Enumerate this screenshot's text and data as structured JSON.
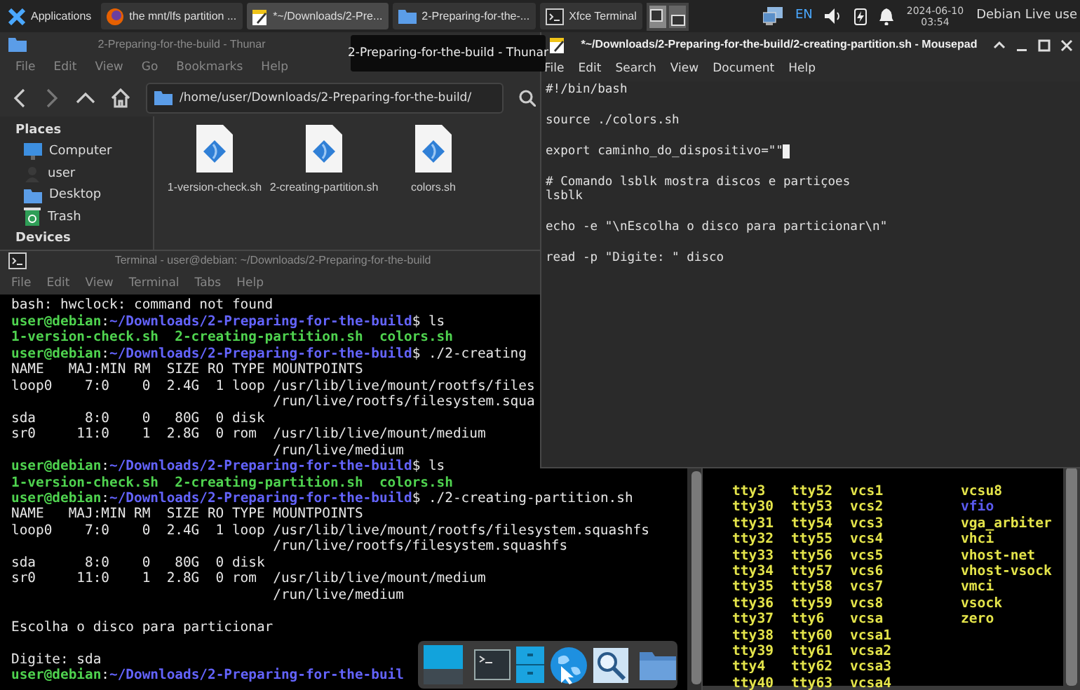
{
  "panel": {
    "menu_button": "Applications",
    "tasks": [
      {
        "label": "the mnt/lfs partition ...",
        "selected": false
      },
      {
        "label": "*~/Downloads/2-Pre...",
        "selected": true
      },
      {
        "label": "2-Preparing-for-the-...",
        "selected": false
      },
      {
        "label": "Xfce Terminal",
        "selected": false
      }
    ],
    "language": "EN",
    "date": "2024-06-10",
    "time": "03:54",
    "user": "Debian Live use"
  },
  "thunar": {
    "title": "2-Preparing-for-the-build - Thunar",
    "active": false,
    "menu": [
      "File",
      "Edit",
      "View",
      "Go",
      "Bookmarks",
      "Help"
    ],
    "path": "/home/user/Downloads/2-Preparing-for-the-build/",
    "sidebar": [
      {
        "kind": "heading",
        "label": "Places"
      },
      {
        "kind": "item",
        "label": "Computer"
      },
      {
        "kind": "item",
        "label": "user"
      },
      {
        "kind": "item",
        "label": "Desktop"
      },
      {
        "kind": "item",
        "label": "Trash"
      },
      {
        "kind": "heading",
        "label": "Devices"
      }
    ],
    "files": [
      {
        "name": "1-version-check.sh"
      },
      {
        "name": "2-creating-partition.sh"
      },
      {
        "name": "colors.sh"
      }
    ]
  },
  "tooltip": "2-Preparing-for-the-build - Thunar",
  "terminal": {
    "title": "Terminal - user@debian: ~/Downloads/2-Preparing-for-the-build",
    "active": false,
    "menu": [
      "File",
      "Edit",
      "View",
      "Terminal",
      "Tabs",
      "Help"
    ],
    "lines": [
      {
        "kind": "output",
        "blank_before": false,
        "text": "bash: hwclock: command not found"
      },
      {
        "kind": "prompt",
        "blank_before": false,
        "user": "user@debian",
        "separator": ":",
        "path": "~/Downloads/2-Preparing-for-the-build",
        "command": "$ ls"
      },
      {
        "kind": "file_list",
        "blank_before": false,
        "text": "1-version-check.sh  2-creating-partition.sh  colors.sh"
      },
      {
        "kind": "prompt",
        "blank_before": false,
        "user": "user@debian",
        "separator": ":",
        "path": "~/Downloads/2-Preparing-for-the-build",
        "command": "$ ./2-creating"
      },
      {
        "kind": "output",
        "blank_before": false,
        "text": "NAME   MAJ:MIN RM  SIZE RO TYPE MOUNTPOINTS"
      },
      {
        "kind": "output",
        "blank_before": false,
        "text": "loop0    7:0    0  2.4G  1 loop /usr/lib/live/mount/rootfs/files"
      },
      {
        "kind": "output",
        "blank_before": false,
        "text": "                                /run/live/rootfs/filesystem.squa"
      },
      {
        "kind": "output",
        "blank_before": false,
        "text": "sda      8:0    0   80G  0 disk"
      },
      {
        "kind": "output",
        "blank_before": false,
        "text": "sr0     11:0    1  2.8G  0 rom  /usr/lib/live/mount/medium"
      },
      {
        "kind": "output",
        "blank_before": false,
        "text": "                                /run/live/medium"
      },
      {
        "kind": "prompt",
        "blank_before": false,
        "user": "user@debian",
        "separator": ":",
        "path": "~/Downloads/2-Preparing-for-the-build",
        "command": "$ ls"
      },
      {
        "kind": "file_list",
        "blank_before": false,
        "text": "1-version-check.sh  2-creating-partition.sh  colors.sh"
      },
      {
        "kind": "prompt",
        "blank_before": false,
        "user": "user@debian",
        "separator": ":",
        "path": "~/Downloads/2-Preparing-for-the-build",
        "command": "$ ./2-creating-partition.sh"
      },
      {
        "kind": "output",
        "blank_before": false,
        "text": "NAME   MAJ:MIN RM  SIZE RO TYPE MOUNTPOINTS"
      },
      {
        "kind": "output",
        "blank_before": false,
        "text": "loop0    7:0    0  2.4G  1 loop /usr/lib/live/mount/rootfs/filesystem.squashfs"
      },
      {
        "kind": "output",
        "blank_before": false,
        "text": "                                /run/live/rootfs/filesystem.squashfs"
      },
      {
        "kind": "output",
        "blank_before": false,
        "text": "sda      8:0    0   80G  0 disk"
      },
      {
        "kind": "output",
        "blank_before": false,
        "text": "sr0     11:0    1  2.8G  0 rom  /usr/lib/live/mount/medium"
      },
      {
        "kind": "output",
        "blank_before": false,
        "text": "                                /run/live/medium"
      },
      {
        "kind": "output",
        "blank_before": true,
        "text": "Escolha o disco para particionar"
      },
      {
        "kind": "output",
        "blank_before": true,
        "text": "Digite: sda"
      },
      {
        "kind": "prompt",
        "blank_before": false,
        "user": "user@debian",
        "separator": ":",
        "path": "~/Downloads/2-Preparing-for-the-buil"
      }
    ]
  },
  "mousepad": {
    "title": "*~/Downloads/2-Preparing-for-the-build/2-creating-partition.sh - Mousepad",
    "active": true,
    "menu": [
      "File",
      "Edit",
      "Search",
      "View",
      "Document",
      "Help"
    ],
    "blocks": [
      [
        {
          "text": "#!/bin/bash",
          "cursor": false
        }
      ],
      [
        {
          "text": "source ./colors.sh",
          "cursor": false
        }
      ],
      [
        {
          "text": "export caminho_do_dispositivo=\"\"",
          "cursor": true
        }
      ],
      [
        {
          "text": "# Comando lsblk mostra discos e partiçoes",
          "cursor": false
        },
        {
          "text": "lsblk",
          "cursor": false
        }
      ],
      [
        {
          "text": "echo -e \"\\nEscolha o disco para particionar\\n\"",
          "cursor": false
        }
      ],
      [
        {
          "text": "read -p \"Digite: \" disco",
          "cursor": false
        }
      ]
    ]
  },
  "terminal_2": {
    "columns": [
      [
        {
          "text": "tty3",
          "kind": "device"
        },
        {
          "text": "tty30",
          "kind": "device"
        },
        {
          "text": "tty31",
          "kind": "device"
        },
        {
          "text": "tty32",
          "kind": "device"
        },
        {
          "text": "tty33",
          "kind": "device"
        },
        {
          "text": "tty34",
          "kind": "device"
        },
        {
          "text": "tty35",
          "kind": "device"
        },
        {
          "text": "tty36",
          "kind": "device"
        },
        {
          "text": "tty37",
          "kind": "device"
        },
        {
          "text": "tty38",
          "kind": "device"
        },
        {
          "text": "tty39",
          "kind": "device"
        },
        {
          "text": "tty4",
          "kind": "device"
        },
        {
          "text": "tty40",
          "kind": "device"
        }
      ],
      [
        {
          "text": "tty52",
          "kind": "device"
        },
        {
          "text": "tty53",
          "kind": "device"
        },
        {
          "text": "tty54",
          "kind": "device"
        },
        {
          "text": "tty55",
          "kind": "device"
        },
        {
          "text": "tty56",
          "kind": "device"
        },
        {
          "text": "tty57",
          "kind": "device"
        },
        {
          "text": "tty58",
          "kind": "device"
        },
        {
          "text": "tty59",
          "kind": "device"
        },
        {
          "text": "tty6",
          "kind": "device"
        },
        {
          "text": "tty60",
          "kind": "device"
        },
        {
          "text": "tty61",
          "kind": "device"
        },
        {
          "text": "tty62",
          "kind": "device"
        },
        {
          "text": "tty63",
          "kind": "device"
        }
      ],
      [
        {
          "text": "vcs1",
          "kind": "device"
        },
        {
          "text": "vcs2",
          "kind": "device"
        },
        {
          "text": "vcs3",
          "kind": "device"
        },
        {
          "text": "vcs4",
          "kind": "device"
        },
        {
          "text": "vcs5",
          "kind": "device"
        },
        {
          "text": "vcs6",
          "kind": "device"
        },
        {
          "text": "vcs7",
          "kind": "device"
        },
        {
          "text": "vcs8",
          "kind": "device"
        },
        {
          "text": "vcsa",
          "kind": "device"
        },
        {
          "text": "vcsa1",
          "kind": "device"
        },
        {
          "text": "vcsa2",
          "kind": "device"
        },
        {
          "text": "vcsa3",
          "kind": "device"
        },
        {
          "text": "vcsa4",
          "kind": "device"
        }
      ],
      [
        {
          "text": "vcsu8",
          "kind": "device"
        },
        {
          "text": "vfio",
          "kind": "directory"
        },
        {
          "text": "vga_arbiter",
          "kind": "device"
        },
        {
          "text": "vhci",
          "kind": "device"
        },
        {
          "text": "vhost-net",
          "kind": "device"
        },
        {
          "text": "vhost-vsock",
          "kind": "device"
        },
        {
          "text": "vmci",
          "kind": "device"
        },
        {
          "text": "vsock",
          "kind": "device"
        },
        {
          "text": "zero",
          "kind": "device"
        }
      ]
    ]
  }
}
